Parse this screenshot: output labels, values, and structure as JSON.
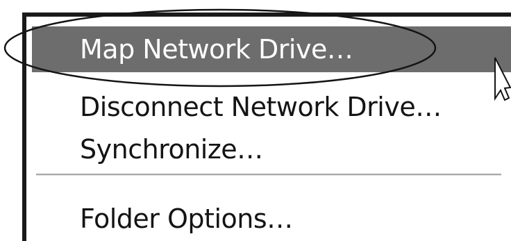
{
  "context_menu": {
    "items": [
      {
        "label": "Map Network Drive…",
        "highlighted": true
      },
      {
        "label": "Disconnect Network Drive…",
        "highlighted": false
      },
      {
        "label": "Synchronize…",
        "highlighted": false
      },
      {
        "label": "Folder Options…",
        "highlighted": false
      }
    ]
  },
  "colors": {
    "highlight": "#6d6d6d",
    "border": "#1a1a1a",
    "separator": "#a9a9a9",
    "annotation": "#141414"
  },
  "icons": {
    "cursor": "arrow-cursor-icon",
    "annotation": "highlight-ellipse-icon"
  }
}
